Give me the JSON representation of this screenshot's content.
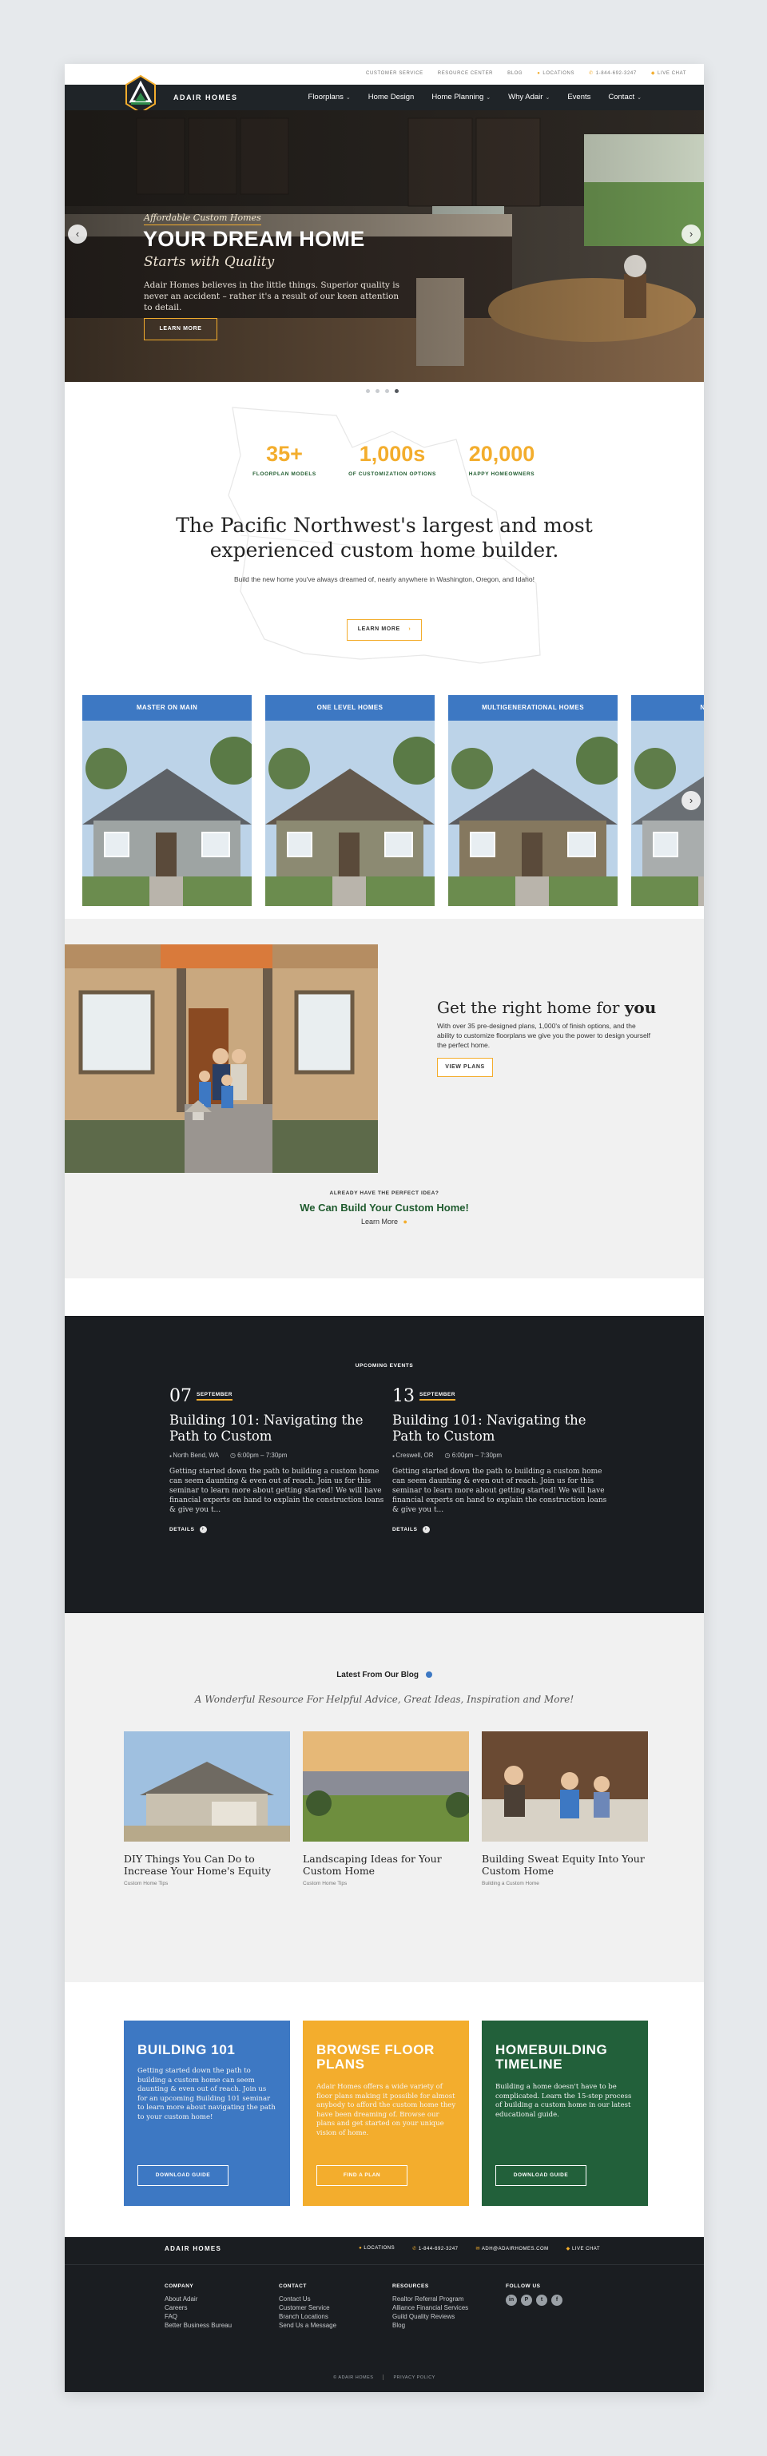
{
  "utility": {
    "customer_service": "CUSTOMER SERVICE",
    "resource_center": "RESOURCE CENTER",
    "blog": "BLOG",
    "locations": "LOCATIONS",
    "phone": "1-844-692-3247",
    "live_chat": "LIVE CHAT"
  },
  "brand": {
    "name": "ADAIR HOMES"
  },
  "nav": {
    "items": [
      {
        "label": "Floorplans",
        "has_menu": true
      },
      {
        "label": "Home Design",
        "has_menu": false
      },
      {
        "label": "Home Planning",
        "has_menu": true
      },
      {
        "label": "Why Adair",
        "has_menu": true
      },
      {
        "label": "Events",
        "has_menu": false
      },
      {
        "label": "Contact",
        "has_menu": true
      }
    ]
  },
  "hero": {
    "kicker": "Affordable Custom Homes",
    "title": "YOUR DREAM HOME",
    "subtitle": "Starts with Quality",
    "description": "Adair Homes believes in the little things. Superior quality is never an accident – rather it's a result of our keen attention to detail.",
    "cta": "LEARN MORE",
    "prev": "‹",
    "next": "›",
    "slide_count": 4,
    "active_slide": 4
  },
  "stats": [
    {
      "num": "35+",
      "label": "FLOORPLAN MODELS"
    },
    {
      "num": "1,000s",
      "label": "OF CUSTOMIZATION OPTIONS"
    },
    {
      "num": "20,000",
      "label": "HAPPY HOMEOWNERS"
    }
  ],
  "intro": {
    "headline": "The Pacific Northwest's largest and most experienced custom home builder.",
    "sub": "Build the new home you've always dreamed of, nearly anywhere in Washington, Oregon, and Idaho!",
    "cta": "LEARN MORE"
  },
  "home_cards": [
    {
      "label": "MASTER ON MAIN"
    },
    {
      "label": "ONE LEVEL HOMES"
    },
    {
      "label": "MULTIGENERATIONAL HOMES"
    },
    {
      "label": "NARROW"
    }
  ],
  "right_home": {
    "title_prefix": "Get the right home for",
    "title_emph": "you",
    "description": "With over 35 pre-designed plans, 1,000's of finish options, and the ability to customize floorplans we give you the power to design yourself the perfect home.",
    "cta": "VIEW PLANS"
  },
  "ideas": {
    "kicker": "ALREADY HAVE THE PERFECT IDEA?",
    "heading": "We Can Build Your Custom Home!",
    "link": "Learn More"
  },
  "events": {
    "heading": "UPCOMING EVENTS",
    "items": [
      {
        "day": "07",
        "month": "SEPTEMBER",
        "title": "Building 101: Navigating the Path to Custom",
        "location": "North Bend, WA",
        "time": "6:00pm – 7:30pm",
        "body": "Getting started down the path to building a custom home can seem daunting & even out of reach. Join us for this seminar to learn more about getting started! We will have financial experts on hand to explain the construction loans & give you t...",
        "details": "DETAILS"
      },
      {
        "day": "13",
        "month": "SEPTEMBER",
        "title": "Building 101: Navigating the Path to Custom",
        "location": "Creswell, OR",
        "time": "6:00pm – 7:30pm",
        "body": "Getting started down the path to building a custom home can seem daunting & even out of reach. Join us for this seminar to learn more about getting started! We will have financial experts on hand to explain the construction loans & give you t...",
        "details": "DETAILS"
      }
    ]
  },
  "blog": {
    "heading": "Latest From Our Blog",
    "sub": "A Wonderful Resource For Helpful Advice, Great Ideas, Inspiration and More!",
    "posts": [
      {
        "title": "DIY Things You Can Do to Increase Your Home's Equity",
        "category": "Custom Home Tips"
      },
      {
        "title": "Landscaping Ideas for Your Custom Home",
        "category": "Custom Home Tips"
      },
      {
        "title": "Building Sweat Equity Into Your Custom Home",
        "category": "Building a Custom Home"
      }
    ]
  },
  "tiles": [
    {
      "title": "BUILDING 101",
      "body": "Getting started down the path to building a custom home can seem daunting & even out of reach. Join us for an upcoming Building 101 seminar to learn more about navigating the path to your custom home!",
      "cta": "DOWNLOAD GUIDE",
      "color": "#3d78c3"
    },
    {
      "title": "BROWSE FLOOR PLANS",
      "body": "Adair Homes offers a wide variety of floor plans making it possible for almost anybody to afford the custom home they have been dreaming of. Browse our plans and get started on your unique vision of home.",
      "cta": "FIND A PLAN",
      "color": "#f3ad2d"
    },
    {
      "title": "HOMEBUILDING TIMELINE",
      "body": "Building a home doesn't have to be complicated. Learn the 15-step process of building a custom home in our latest educational guide.",
      "cta": "DOWNLOAD GUIDE",
      "color": "#22603a"
    }
  ],
  "footer": {
    "brand": "ADAIR HOMES",
    "locations": "LOCATIONS",
    "phone": "1-844-692-3247",
    "email": "ADH@ADAIRHOMES.COM",
    "live_chat": "LIVE CHAT",
    "columns": [
      {
        "heading": "COMPANY",
        "links": [
          "About Adair",
          "Careers",
          "FAQ",
          "Better Business Bureau"
        ]
      },
      {
        "heading": "CONTACT",
        "links": [
          "Contact Us",
          "Customer Service",
          "Branch Locations",
          "Send Us a Message"
        ]
      },
      {
        "heading": "RESOURCES",
        "links": [
          "Realtor Referral Program",
          "Alliance Financial Services",
          "Guild Quality Reviews",
          "Blog"
        ]
      },
      {
        "heading": "FOLLOW US",
        "links": []
      }
    ],
    "social": [
      "in",
      "P",
      "t",
      "f"
    ],
    "copyright": "© ADAIR HOMES",
    "privacy": "PRIVACY POLICY"
  }
}
